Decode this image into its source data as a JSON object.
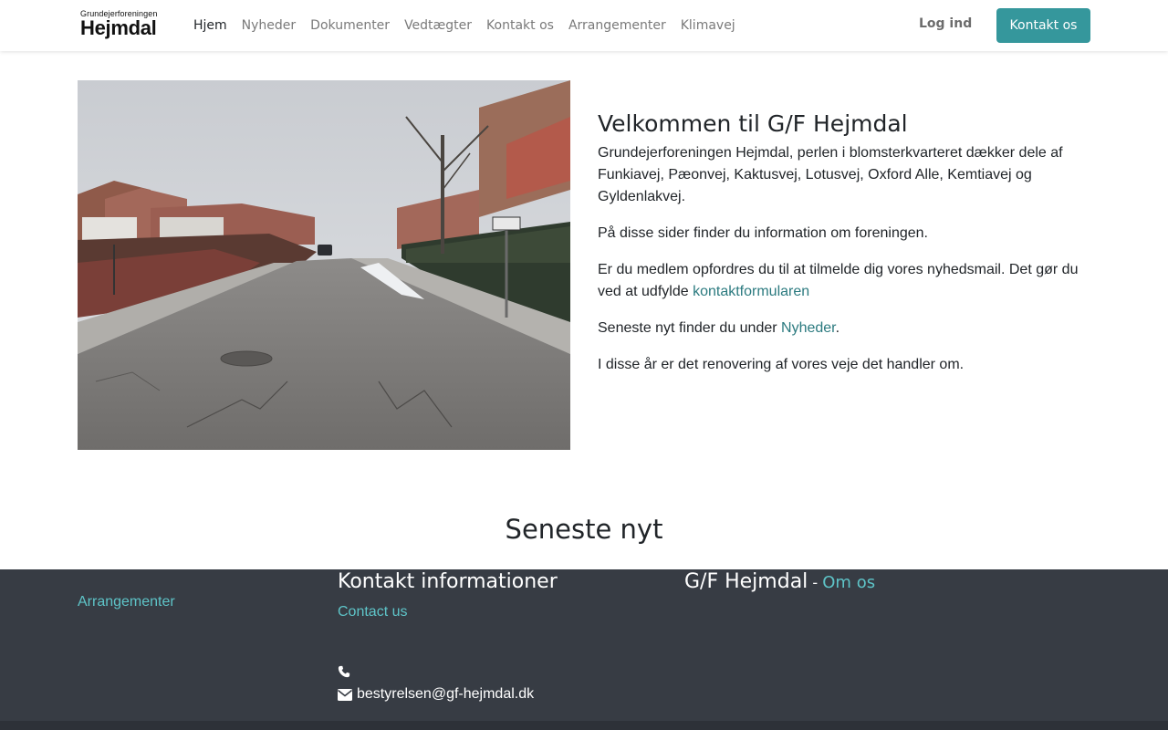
{
  "header": {
    "logo": {
      "small_text": "Grundejerforeningen",
      "big_text": "Hejmdal"
    },
    "nav": [
      {
        "label": "Hjem",
        "active": true
      },
      {
        "label": "Nyheder"
      },
      {
        "label": "Dokumenter"
      },
      {
        "label": "Vedtægter"
      },
      {
        "label": "Kontakt os"
      },
      {
        "label": "Arrangementer"
      },
      {
        "label": "Klimavej"
      }
    ],
    "login_label": "Log ind",
    "cta_label": "Kontakt os"
  },
  "intro": {
    "title": "Velkommen til G/F Hejmdal",
    "p1": "Grundejerforeningen Hejmdal, perlen i blomsterkvarteret dækker dele af Funkiavej, Pæonvej, Kaktusvej, Lotusvej, Oxford Alle, Kemtiavej og Gyldenlakvej.",
    "p2": "På disse sider finder du information om foreningen.",
    "p3_text": "Er du medlem opfordres du til at tilmelde dig vores nyhedsmail. Det gør du ved at udfylde ",
    "p3_link": "kontaktformularen",
    "p4_text": "Seneste nyt finder du under ",
    "p4_link": "Nyheder",
    "p4_end": ".",
    "p5": "I disse år er det renovering af vores veje det handler om."
  },
  "news": {
    "title": "Seneste nyt"
  },
  "footer": {
    "col1_link": "Arrangementer",
    "col2_title": "Kontakt informationer",
    "col2_link": "Contact us",
    "email": "bestyrelsen@gf-hejmdal.dk",
    "col3_title": "G/F Hejmdal",
    "col3_sep": "-",
    "col3_link": "Om os"
  },
  "colors": {
    "accent": "#35979c",
    "link": "#2b7a7f",
    "footer_bg": "#373c44",
    "footer_link": "#5ec4c8"
  },
  "icons": {
    "phone": "phone-icon",
    "email": "envelope-icon"
  }
}
